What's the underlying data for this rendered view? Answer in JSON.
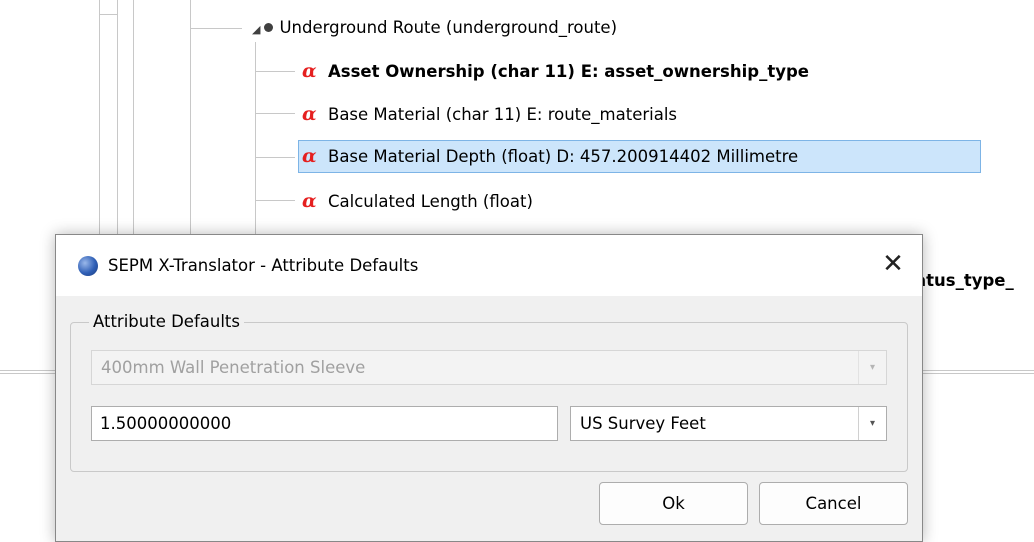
{
  "tree": {
    "parent_label": "Underground Route (underground_route)",
    "attributes": [
      {
        "label": "Asset Ownership  (char 11)  E: asset_ownership_type",
        "bold": true
      },
      {
        "label": "Base Material  (char 11)  E: route_materials",
        "bold": false
      },
      {
        "label": "Base Material Depth  (float)    D: 457.200914402 Millimetre",
        "bold": false,
        "selected": true
      },
      {
        "label": "Calculated Length  (float)",
        "bold": false
      }
    ],
    "partial_hidden_text": "atus_type_"
  },
  "dialog": {
    "title": "SEPM X-Translator - Attribute Defaults",
    "close_glyph": "✕",
    "group_label": "Attribute Defaults",
    "object_combo": {
      "value": "400mm Wall Penetration Sleeve",
      "disabled": true
    },
    "value_input": {
      "value": "1.50000000000"
    },
    "unit_combo": {
      "value": "US Survey Feet"
    },
    "ok_label": "Ok",
    "cancel_label": "Cancel",
    "dropdown_glyph": "▾"
  },
  "icons": {
    "attribute": "alpha-icon",
    "title": "globe-icon"
  },
  "colors": {
    "attribute_icon": "#e51f1f",
    "selection_bg": "#cce5fb",
    "selection_border": "#7db4e6"
  }
}
